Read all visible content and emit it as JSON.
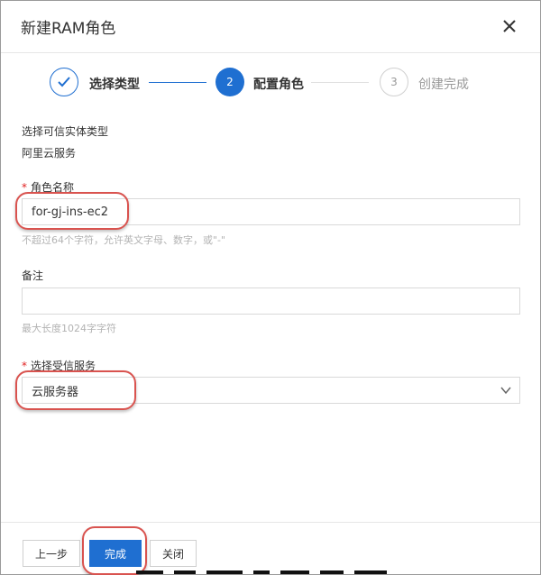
{
  "dialog": {
    "title": "新建RAM角色"
  },
  "steps": [
    {
      "label": "选择类型",
      "state": "done"
    },
    {
      "label": "配置角色",
      "state": "active",
      "number": "2"
    },
    {
      "label": "创建完成",
      "state": "todo",
      "number": "3"
    }
  ],
  "form": {
    "trusted_entity_label": "选择可信实体类型",
    "trusted_entity_value": "阿里云服务",
    "role_name_label": "角色名称",
    "role_name_value": "for-gj-ins-ec2",
    "role_name_hint": "不超过64个字符，允许英文字母、数字，或\"-\"",
    "remark_label": "备注",
    "remark_value": "",
    "remark_hint": "最大长度1024字字符",
    "service_label": "选择受信服务",
    "service_value": "云服务器"
  },
  "footer": {
    "prev_label": "上一步",
    "done_label": "完成",
    "close_label": "关闭"
  },
  "colors": {
    "primary": "#1f6fd1",
    "required": "#e02020",
    "annotation": "#d9534f"
  }
}
